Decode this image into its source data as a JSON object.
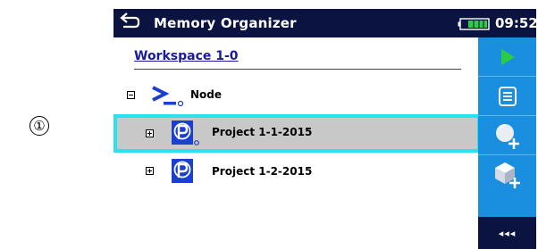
{
  "marker": {
    "label": "①"
  },
  "header": {
    "title": "Memory Organizer",
    "time": "09:52"
  },
  "workspace": {
    "title": "Workspace 1-0"
  },
  "tree": {
    "node": {
      "label": "Node"
    },
    "projects": [
      {
        "label": "Project 1-1-2015",
        "selected": true
      },
      {
        "label": "Project 1-2-2015",
        "selected": false
      }
    ]
  },
  "sidebar": {
    "buttons": [
      "play-icon",
      "list-icon",
      "add-node-icon",
      "add-project-icon"
    ],
    "more_label": "◂◂◂"
  },
  "colors": {
    "titlebar": "#0b1440",
    "sidebar": "#1a8fe0",
    "selection_border": "#27e3ee",
    "selection_fill": "#c8c8c8",
    "play_green": "#2ecc40"
  }
}
